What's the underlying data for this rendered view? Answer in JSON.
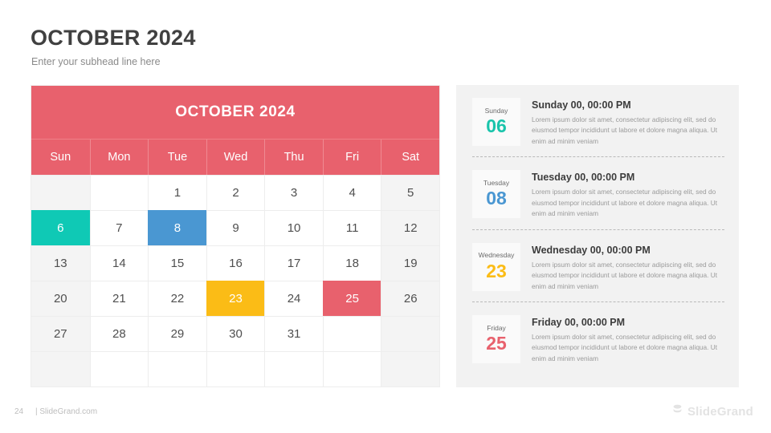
{
  "slide": {
    "title": "OCTOBER 2024",
    "subhead": "Enter your subhead line here"
  },
  "calendar": {
    "title": "OCTOBER 2024",
    "day_headers": [
      "Sun",
      "Mon",
      "Tue",
      "Wed",
      "Thu",
      "Fri",
      "Sat"
    ],
    "header_color": "#e8616d",
    "weeks": [
      [
        {
          "day": ""
        },
        {
          "day": ""
        },
        {
          "day": "1"
        },
        {
          "day": "2"
        },
        {
          "day": "3"
        },
        {
          "day": "4"
        },
        {
          "day": "5"
        }
      ],
      [
        {
          "day": "6",
          "highlight": "#0fc9b5"
        },
        {
          "day": "7"
        },
        {
          "day": "8",
          "highlight": "#4a97d2"
        },
        {
          "day": "9"
        },
        {
          "day": "10"
        },
        {
          "day": "11"
        },
        {
          "day": "12"
        }
      ],
      [
        {
          "day": "13"
        },
        {
          "day": "14"
        },
        {
          "day": "15"
        },
        {
          "day": "16"
        },
        {
          "day": "17"
        },
        {
          "day": "18"
        },
        {
          "day": "19"
        }
      ],
      [
        {
          "day": "20"
        },
        {
          "day": "21"
        },
        {
          "day": "22"
        },
        {
          "day": "23",
          "highlight": "#fbbc16"
        },
        {
          "day": "24"
        },
        {
          "day": "25",
          "highlight": "#e8616d"
        },
        {
          "day": "26"
        }
      ],
      [
        {
          "day": "27"
        },
        {
          "day": "28"
        },
        {
          "day": "29"
        },
        {
          "day": "30"
        },
        {
          "day": "31"
        },
        {
          "day": ""
        },
        {
          "day": ""
        }
      ],
      [
        {
          "day": ""
        },
        {
          "day": ""
        },
        {
          "day": ""
        },
        {
          "day": ""
        },
        {
          "day": ""
        },
        {
          "day": ""
        },
        {
          "day": ""
        }
      ]
    ]
  },
  "events": [
    {
      "dow": "Sunday",
      "day": "06",
      "color": "#19c4ab",
      "heading": "Sunday 00, 00:00 PM",
      "text": "Lorem ipsum dolor sit amet, consectetur adipiscing elit, sed do eiusmod tempor incididunt ut labore et dolore magna aliqua. Ut enim ad minim veniam"
    },
    {
      "dow": "Tuesday",
      "day": "08",
      "color": "#4a97d2",
      "heading": "Tuesday 00, 00:00 PM",
      "text": "Lorem ipsum dolor sit amet, consectetur adipiscing elit, sed do eiusmod tempor incididunt ut labore et dolore magna aliqua. Ut enim ad minim veniam"
    },
    {
      "dow": "Wednesday",
      "day": "23",
      "color": "#fbbc16",
      "heading": "Wednesday 00, 00:00 PM",
      "text": "Lorem ipsum dolor sit amet, consectetur adipiscing elit, sed do eiusmod tempor incididunt ut labore et dolore magna aliqua. Ut enim ad minim veniam"
    },
    {
      "dow": "Friday",
      "day": "25",
      "color": "#e8616d",
      "heading": "Friday 00, 00:00 PM",
      "text": "Lorem ipsum dolor sit amet, consectetur adipiscing elit, sed do eiusmod tempor incididunt ut labore et dolore magna aliqua. Ut enim ad minim veniam"
    }
  ],
  "footer": {
    "page_number": "24",
    "site": "| SlideGrand.com",
    "brand_name": "SlideGrand"
  }
}
